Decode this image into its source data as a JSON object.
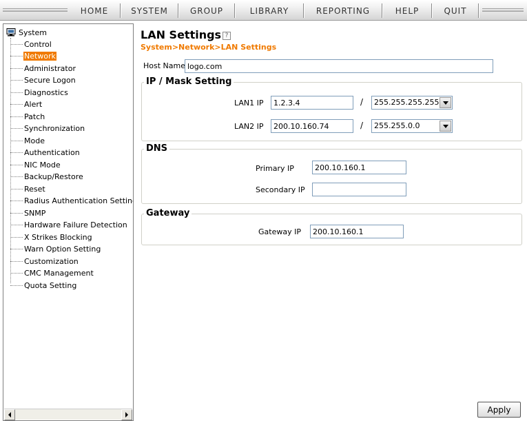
{
  "nav": {
    "items": [
      "HOME",
      "SYSTEM",
      "GROUP",
      "LIBRARY",
      "REPORTING",
      "HELP",
      "QUIT"
    ]
  },
  "sidebar": {
    "root": "System",
    "selected_index": 1,
    "items": [
      "Control",
      "Network",
      "Administrator",
      "Secure Logon",
      "Diagnostics",
      "Alert",
      "Patch",
      "Synchronization",
      "Mode",
      "Authentication",
      "NIC Mode",
      "Backup/Restore",
      "Reset",
      "Radius Authentication Setting",
      "SNMP",
      "Hardware Failure Detection",
      "X Strikes Blocking",
      "Warn Option Setting",
      "Customization",
      "CMC Management",
      "Quota Setting"
    ]
  },
  "page": {
    "title": "LAN Settings",
    "breadcrumb": "System>Network>LAN Settings"
  },
  "host": {
    "label": "Host Name",
    "value": "logo.com"
  },
  "ipmask": {
    "legend": "IP / Mask Setting",
    "separator": "/",
    "lan1_label": "LAN1 IP",
    "lan1_value": "1.2.3.4",
    "lan1_mask": "255.255.255.255",
    "lan2_label": "LAN2 IP",
    "lan2_value": "200.10.160.74",
    "lan2_mask": "255.255.0.0"
  },
  "dns": {
    "legend": "DNS",
    "primary_label": "Primary IP",
    "primary_value": "200.10.160.1",
    "secondary_label": "Secondary IP",
    "secondary_value": ""
  },
  "gateway": {
    "legend": "Gateway",
    "ip_label": "Gateway IP",
    "ip_value": "200.10.160.1"
  },
  "actions": {
    "apply": "Apply"
  },
  "colors": {
    "accent": "#f07a00",
    "border": "#7f9db9"
  },
  "icons": {
    "root": "computer-icon",
    "help": "help-icon",
    "scroll_left": "scroll-left-icon",
    "scroll_right": "scroll-right-icon",
    "dropdown": "chevron-down-icon"
  }
}
